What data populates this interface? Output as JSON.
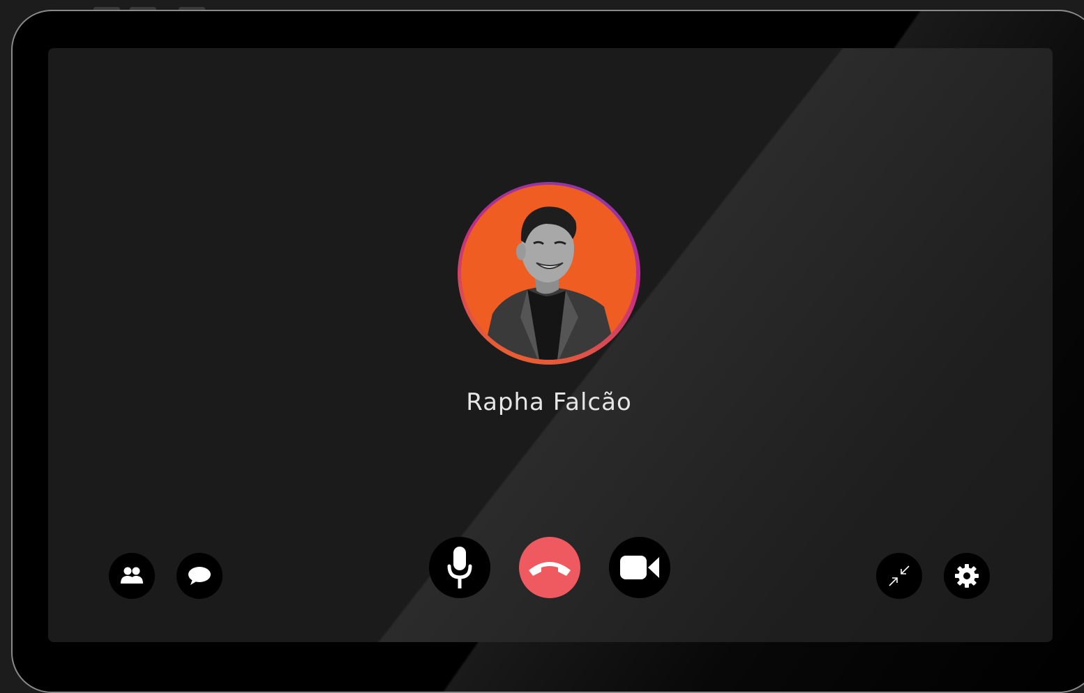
{
  "call": {
    "caller_name": "Rapha Falcão",
    "status": "in-call"
  },
  "controls": {
    "left": [
      {
        "name": "participants",
        "icon": "participants-icon"
      },
      {
        "name": "chat",
        "icon": "chat-bubble-icon"
      }
    ],
    "center": [
      {
        "name": "microphone",
        "icon": "microphone-icon"
      },
      {
        "name": "end-call",
        "icon": "phone-hangup-icon"
      },
      {
        "name": "camera",
        "icon": "video-camera-icon"
      }
    ],
    "right": [
      {
        "name": "minimize",
        "icon": "minimize-arrows-icon"
      },
      {
        "name": "settings",
        "icon": "gear-icon"
      }
    ]
  },
  "colors": {
    "end_call": "#ee5a5f",
    "avatar_bg": "#ef5d22",
    "screen_bg": "#1b1b1b",
    "button_bg": "#000000",
    "icon": "#ffffff"
  }
}
